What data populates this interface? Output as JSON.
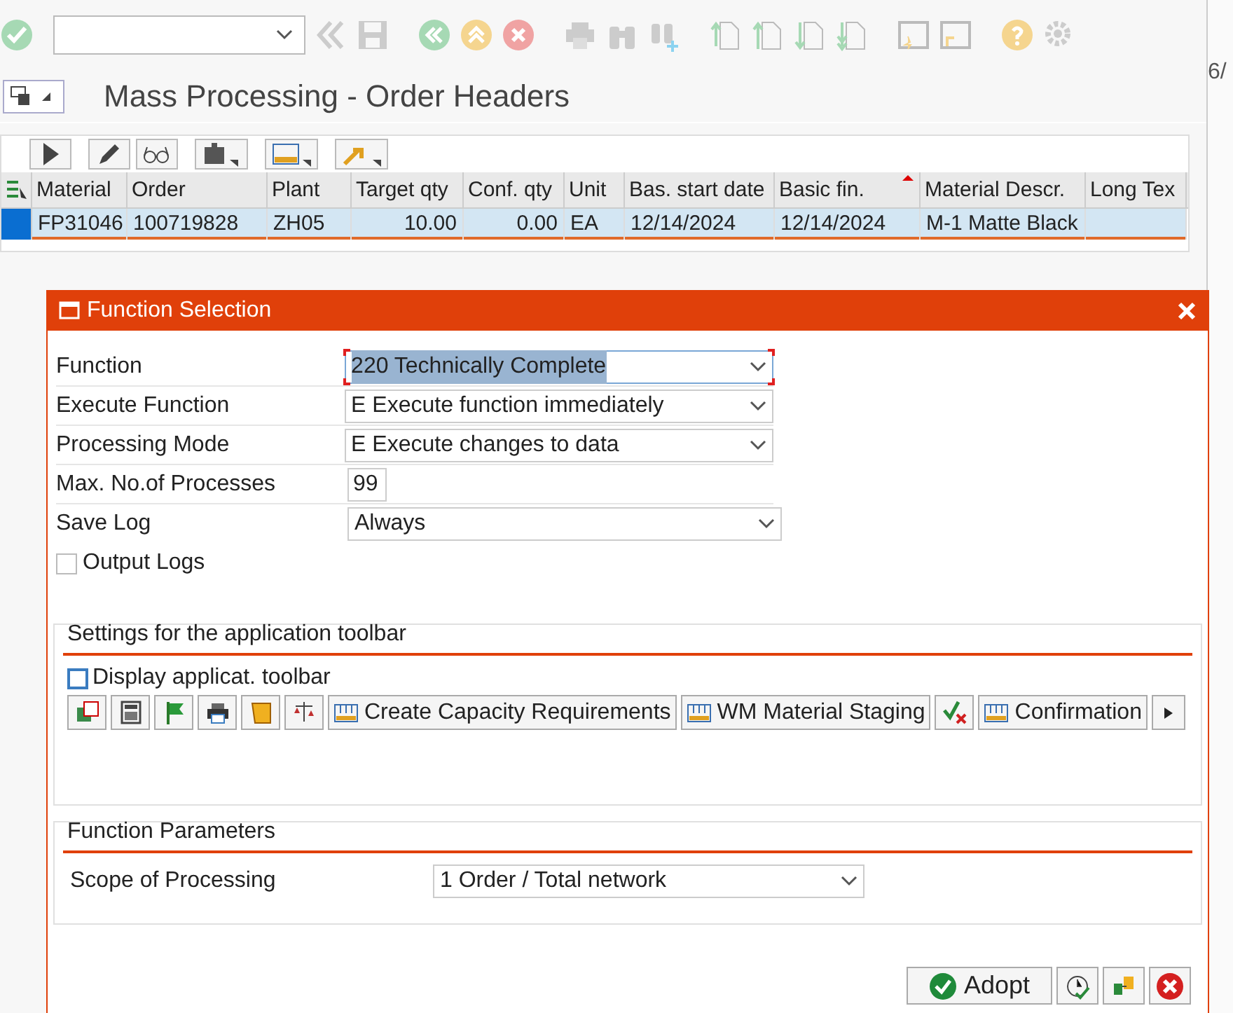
{
  "title": "Mass Processing - Order Headers",
  "table": {
    "columns": [
      {
        "label": "Material",
        "sorted": false
      },
      {
        "label": "Order",
        "sorted": false
      },
      {
        "label": "Plant",
        "sorted": false
      },
      {
        "label": "Target qty",
        "sorted": false
      },
      {
        "label": "Conf. qty",
        "sorted": false
      },
      {
        "label": "Unit",
        "sorted": false
      },
      {
        "label": "Bas. start date",
        "sorted": false
      },
      {
        "label": "Basic fin.",
        "sorted": true
      },
      {
        "label": "Material Descr.",
        "sorted": false
      },
      {
        "label": "Long Tex",
        "sorted": false
      }
    ],
    "rows": [
      {
        "selected": true,
        "cells": [
          "FP31046",
          "100719828",
          "ZH05",
          "10.00",
          "0.00",
          "EA",
          "12/14/2024",
          "12/14/2024",
          "M-1 Matte Black",
          ""
        ]
      }
    ]
  },
  "dialog": {
    "title": "Function Selection",
    "fields": [
      {
        "label": "Function",
        "kind": "dropdown",
        "value": "220 Technically Complete",
        "focused": true
      },
      {
        "label": "Execute Function",
        "kind": "dropdown",
        "value": "E Execute function immediately",
        "focused": false
      },
      {
        "label": "Processing Mode",
        "kind": "dropdown",
        "value": "E Execute changes to data",
        "focused": false
      },
      {
        "label": "Max. No.of Processes",
        "kind": "input",
        "value": "99",
        "focused": false
      },
      {
        "label": "Save Log",
        "kind": "dropdown",
        "value": "Always",
        "focused": false
      }
    ],
    "output_logs": {
      "label": "Output Logs",
      "checked": false
    },
    "toolbar_settings": {
      "title": "Settings for the application toolbar",
      "display": {
        "label": "Display applicat. toolbar",
        "checked": false
      },
      "buttons": [
        "Create Capacity Requirements",
        "WM Material Staging",
        "Confirmation"
      ]
    },
    "function_parameters": {
      "title": "Function Parameters",
      "fields": [
        {
          "label": "Scope of Processing",
          "value": "1 Order / Total network"
        }
      ]
    },
    "buttons": [
      {
        "label": "Adopt"
      }
    ]
  },
  "background_window": {
    "text": "6/"
  }
}
